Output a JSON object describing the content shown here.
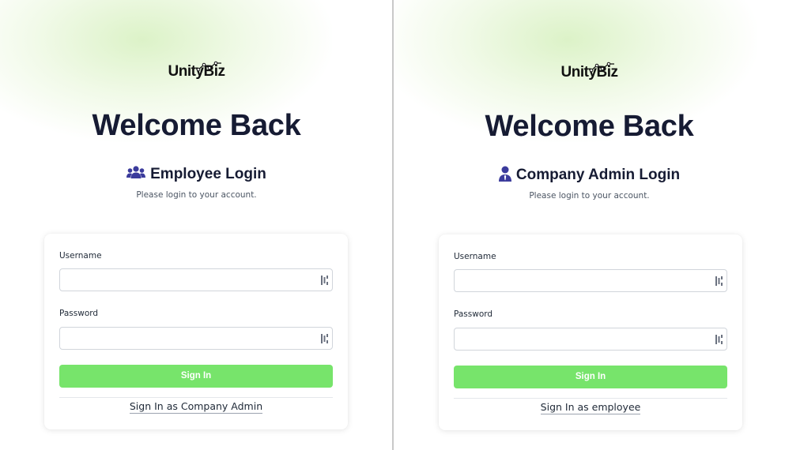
{
  "brand": {
    "name": "UnityBiz"
  },
  "colors": {
    "accent_green": "#77e46b",
    "heading": "#161b33",
    "icon_indigo": "#3b3b9c"
  },
  "employee_panel": {
    "welcome": "Welcome Back",
    "login_title": "Employee Login",
    "login_icon": "users-icon",
    "subtitle": "Please login to your account.",
    "username_label": "Username",
    "username_value": "",
    "password_label": "Password",
    "password_value": "",
    "sign_in_label": "Sign In",
    "switch_link": "Sign In as Company Admin"
  },
  "admin_panel": {
    "welcome": "Welcome Back",
    "login_title": "Company Admin Login",
    "login_icon": "user-tie-icon",
    "subtitle": "Please login to your account.",
    "username_label": "Username",
    "username_value": "",
    "password_label": "Password",
    "password_value": "",
    "sign_in_label": "Sign In",
    "switch_link": "Sign In as employee"
  }
}
